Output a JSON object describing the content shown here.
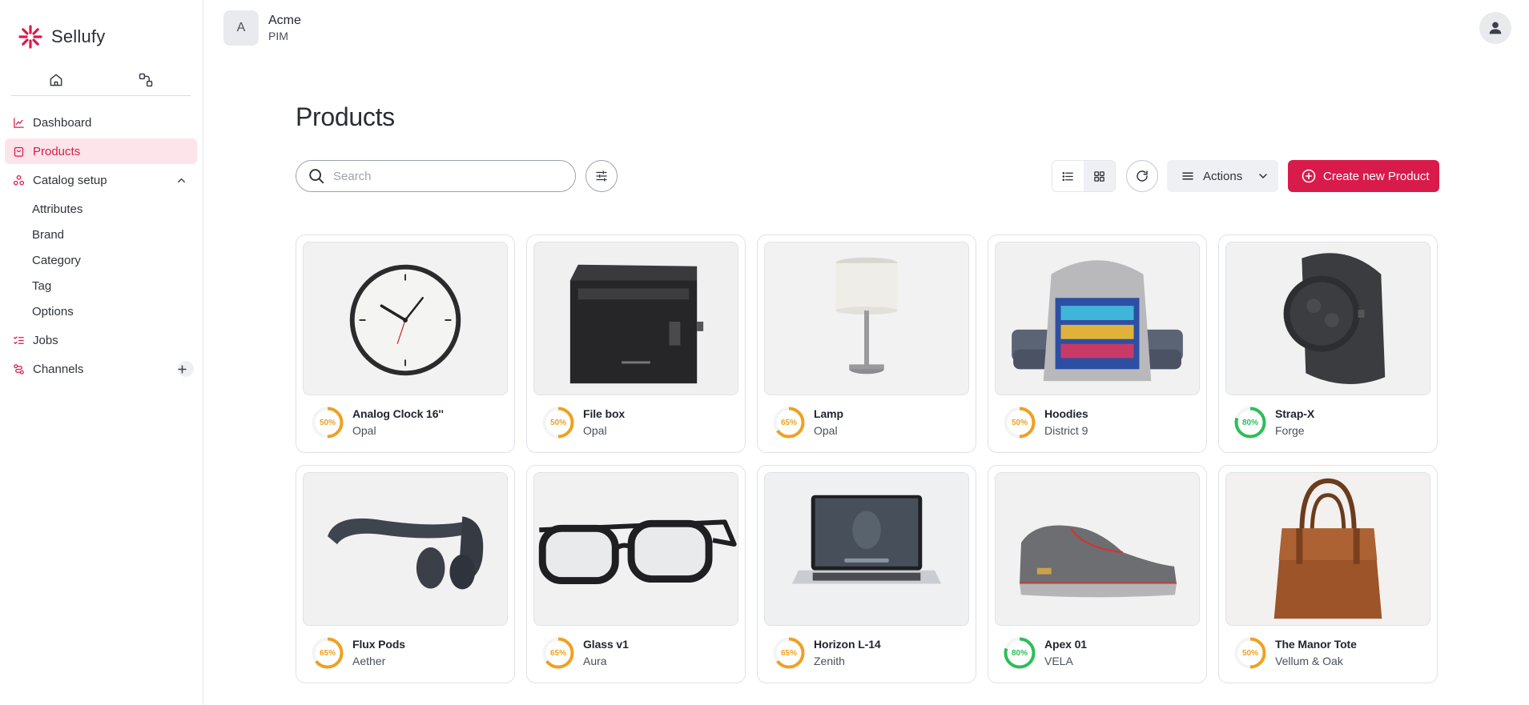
{
  "app": {
    "name": "Sellufy"
  },
  "workspace": {
    "avatar_letter": "A",
    "name": "Acme",
    "subtitle": "PIM"
  },
  "sidebar": {
    "items": [
      {
        "label": "Dashboard",
        "icon": "chart-line-icon"
      },
      {
        "label": "Products",
        "icon": "shopping-bag-icon",
        "active": true
      },
      {
        "label": "Catalog setup",
        "icon": "shapes-icon",
        "expanded": true,
        "children": [
          "Attributes",
          "Brand",
          "Category",
          "Tag",
          "Options"
        ]
      },
      {
        "label": "Jobs",
        "icon": "list-checks-icon"
      },
      {
        "label": "Channels",
        "icon": "route-icon"
      }
    ]
  },
  "main": {
    "title": "Products",
    "search": {
      "placeholder": "Search",
      "value": ""
    },
    "actions_label": "Actions",
    "create_label": "Create new Product"
  },
  "colors": {
    "accent": "#d81b4a",
    "score_orange": "#f0a020",
    "score_green": "#2ebd59"
  },
  "products": [
    {
      "name": "Analog Clock 16''",
      "brand": "Opal",
      "score": "50%",
      "image": "clock"
    },
    {
      "name": "File box",
      "brand": "Opal",
      "score": "50%",
      "image": "filebox"
    },
    {
      "name": "Lamp",
      "brand": "Opal",
      "score": "65%",
      "image": "lamp"
    },
    {
      "name": "Hoodies",
      "brand": "District 9",
      "score": "50%",
      "image": "hoodie"
    },
    {
      "name": "Strap-X",
      "brand": "Forge",
      "score": "80%",
      "image": "watch"
    },
    {
      "name": "Flux Pods",
      "brand": "Aether",
      "score": "65%",
      "image": "headphones"
    },
    {
      "name": "Glass v1",
      "brand": "Aura",
      "score": "65%",
      "image": "glasses"
    },
    {
      "name": "Horizon L-14",
      "brand": "Zenith",
      "score": "65%",
      "image": "laptop"
    },
    {
      "name": "Apex 01",
      "brand": "VELA",
      "score": "80%",
      "image": "sneaker"
    },
    {
      "name": "The Manor Tote",
      "brand": "Vellum & Oak",
      "score": "50%",
      "image": "tote"
    }
  ]
}
